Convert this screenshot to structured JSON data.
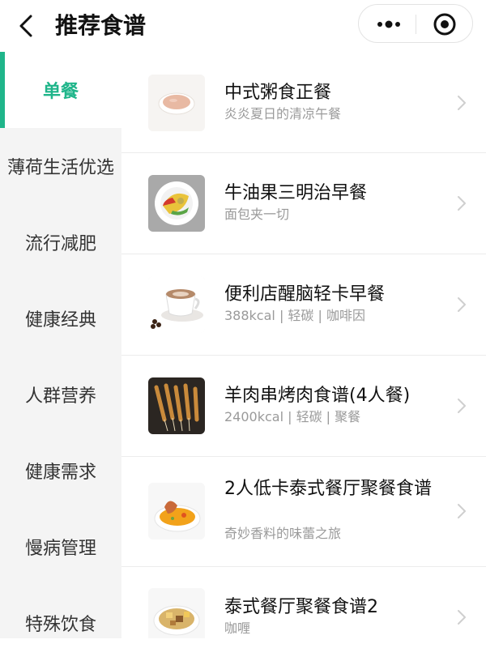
{
  "header": {
    "title": "推荐食谱",
    "back_icon": "back-arrow-icon",
    "more_icon": "more-dots-icon",
    "close_icon": "target-close-icon"
  },
  "sidebar": {
    "accent_color": "#1fb58a",
    "items": [
      {
        "label": "单餐",
        "active": true
      },
      {
        "label": "薄荷生活优选",
        "active": false
      },
      {
        "label": "流行减肥",
        "active": false
      },
      {
        "label": "健康经典",
        "active": false
      },
      {
        "label": "人群营养",
        "active": false
      },
      {
        "label": "健康需求",
        "active": false
      },
      {
        "label": "慢病管理",
        "active": false
      },
      {
        "label": "特殊饮食",
        "active": false
      }
    ]
  },
  "recipes": [
    {
      "title": "中式粥食正餐",
      "subtitle": "炎炎夏日的清凉午餐",
      "thumb_icon": "porridge-bowl-icon"
    },
    {
      "title": "牛油果三明治早餐",
      "subtitle": "面包夹一切",
      "thumb_icon": "sandwich-plate-icon"
    },
    {
      "title": "便利店醒脑轻卡早餐",
      "subtitle": "388kcal | 轻碳 | 咖啡因",
      "thumb_icon": "coffee-cup-icon"
    },
    {
      "title": "羊肉串烤肉食谱(4人餐)",
      "subtitle": "2400kcal | 轻碳 | 聚餐",
      "thumb_icon": "skewers-icon"
    },
    {
      "title": "2人低卡泰式餐厅聚餐食谱",
      "subtitle": "奇妙香料的味蕾之旅",
      "thumb_icon": "thai-soup-icon"
    },
    {
      "title": "泰式餐厅聚餐食谱2",
      "subtitle": "咖喱",
      "thumb_icon": "curry-bowl-icon"
    }
  ]
}
